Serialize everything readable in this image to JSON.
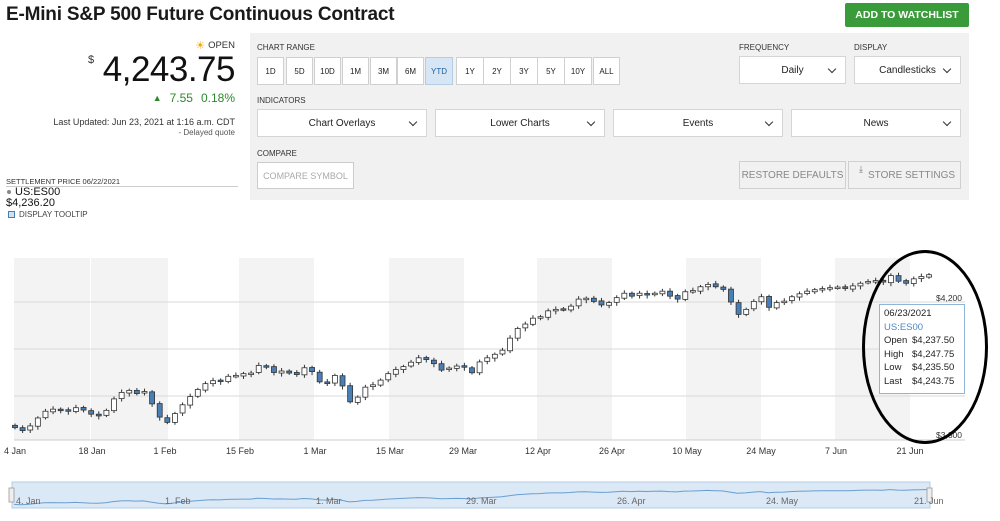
{
  "page": {
    "title": "E-Mini S&P 500 Future Continuous Contract"
  },
  "watchlist_label": "ADD TO WATCHLIST",
  "quote": {
    "status": "OPEN",
    "currency": "$",
    "price": "4,243.75",
    "change": "7.55",
    "change_pct": "0.18%",
    "last_updated": "Last Updated: Jun 23, 2021 at 1:16 a.m. CDT",
    "delayed": "- Delayed quote",
    "settle_label": "SETTLEMENT PRICE 06/22/2021",
    "settle_value": "$4,236.20",
    "symbol": "US:ES00"
  },
  "tooltip_toggle_label": "DISPLAY TOOLTIP",
  "controls": {
    "chart_range_label": "CHART RANGE",
    "ranges": [
      "1D",
      "5D",
      "10D",
      "1M",
      "3M",
      "6M",
      "YTD",
      "1Y",
      "2Y",
      "3Y",
      "5Y",
      "10Y",
      "ALL"
    ],
    "active_range": "YTD",
    "frequency_label": "FREQUENCY",
    "frequency_value": "Daily",
    "display_label": "DISPLAY",
    "display_value": "Candlesticks",
    "indicators_label": "INDICATORS",
    "indicators": [
      "Chart Overlays",
      "Lower Charts",
      "Events",
      "News"
    ],
    "compare_label": "COMPARE",
    "compare_placeholder": "COMPARE SYMBOL",
    "restore_label": "RESTORE DEFAULTS",
    "store_label": "STORE SETTINGS"
  },
  "chart_data": {
    "type": "candlestick",
    "title": "",
    "xlabel": "",
    "ylabel": "",
    "x_ticks": [
      "4 Jan",
      "18 Jan",
      "1 Feb",
      "15 Feb",
      "1 Mar",
      "15 Mar",
      "29 Mar",
      "12 Apr",
      "26 Apr",
      "10 May",
      "24 May",
      "7 Jun",
      "21 Jun"
    ],
    "y_ticks_visible": [
      "$4,200",
      "$3,800"
    ],
    "ylim": [
      3680,
      4300
    ],
    "closes": [
      3722,
      3712,
      3728,
      3755,
      3778,
      3785,
      3781,
      3778,
      3790,
      3782,
      3768,
      3762,
      3781,
      3820,
      3842,
      3849,
      3838,
      3845,
      3803,
      3758,
      3740,
      3770,
      3800,
      3828,
      3852,
      3872,
      3882,
      3880,
      3897,
      3900,
      3906,
      3908,
      3934,
      3929,
      3910,
      3915,
      3908,
      3903,
      3926,
      3913,
      3878,
      3872,
      3900,
      3864,
      3810,
      3826,
      3860,
      3868,
      3884,
      3906,
      3920,
      3930,
      3945,
      3960,
      3954,
      3940,
      3918,
      3925,
      3932,
      3928,
      3909,
      3946,
      3960,
      3972,
      3986,
      4027,
      4060,
      4075,
      4095,
      4100,
      4120,
      4125,
      4124,
      4136,
      4160,
      4163,
      4152,
      4140,
      4148,
      4165,
      4180,
      4170,
      4180,
      4174,
      4180,
      4187,
      4170,
      4160,
      4185,
      4189,
      4202,
      4210,
      4202,
      4193,
      4150,
      4108,
      4125,
      4152,
      4168,
      4132,
      4148,
      4153,
      4168,
      4178,
      4187,
      4192,
      4196,
      4199,
      4201,
      4196,
      4205,
      4214,
      4220,
      4223,
      4218,
      4240,
      4221,
      4214,
      4229,
      4237,
      4243
    ],
    "last_candle": {
      "date": "06/23/2021",
      "symbol": "US:ES00",
      "open": "$4,237.50",
      "high": "$4,247.75",
      "low": "$4,235.50",
      "last": "$4,243.75"
    },
    "tooltip_labels": {
      "open": "Open",
      "high": "High",
      "low": "Low",
      "last": "Last"
    },
    "navigator_ticks": [
      "4. Jan",
      "1. Feb",
      "1. Mar",
      "29. Mar",
      "26. Apr",
      "24. May",
      "21. Jun"
    ],
    "grid": true,
    "colors": {
      "candle": "#333333",
      "bearish_fill": "#4a7fb5",
      "navigator_line": "#6a9ed0",
      "navigator_fill": "#dbe8f5"
    }
  }
}
